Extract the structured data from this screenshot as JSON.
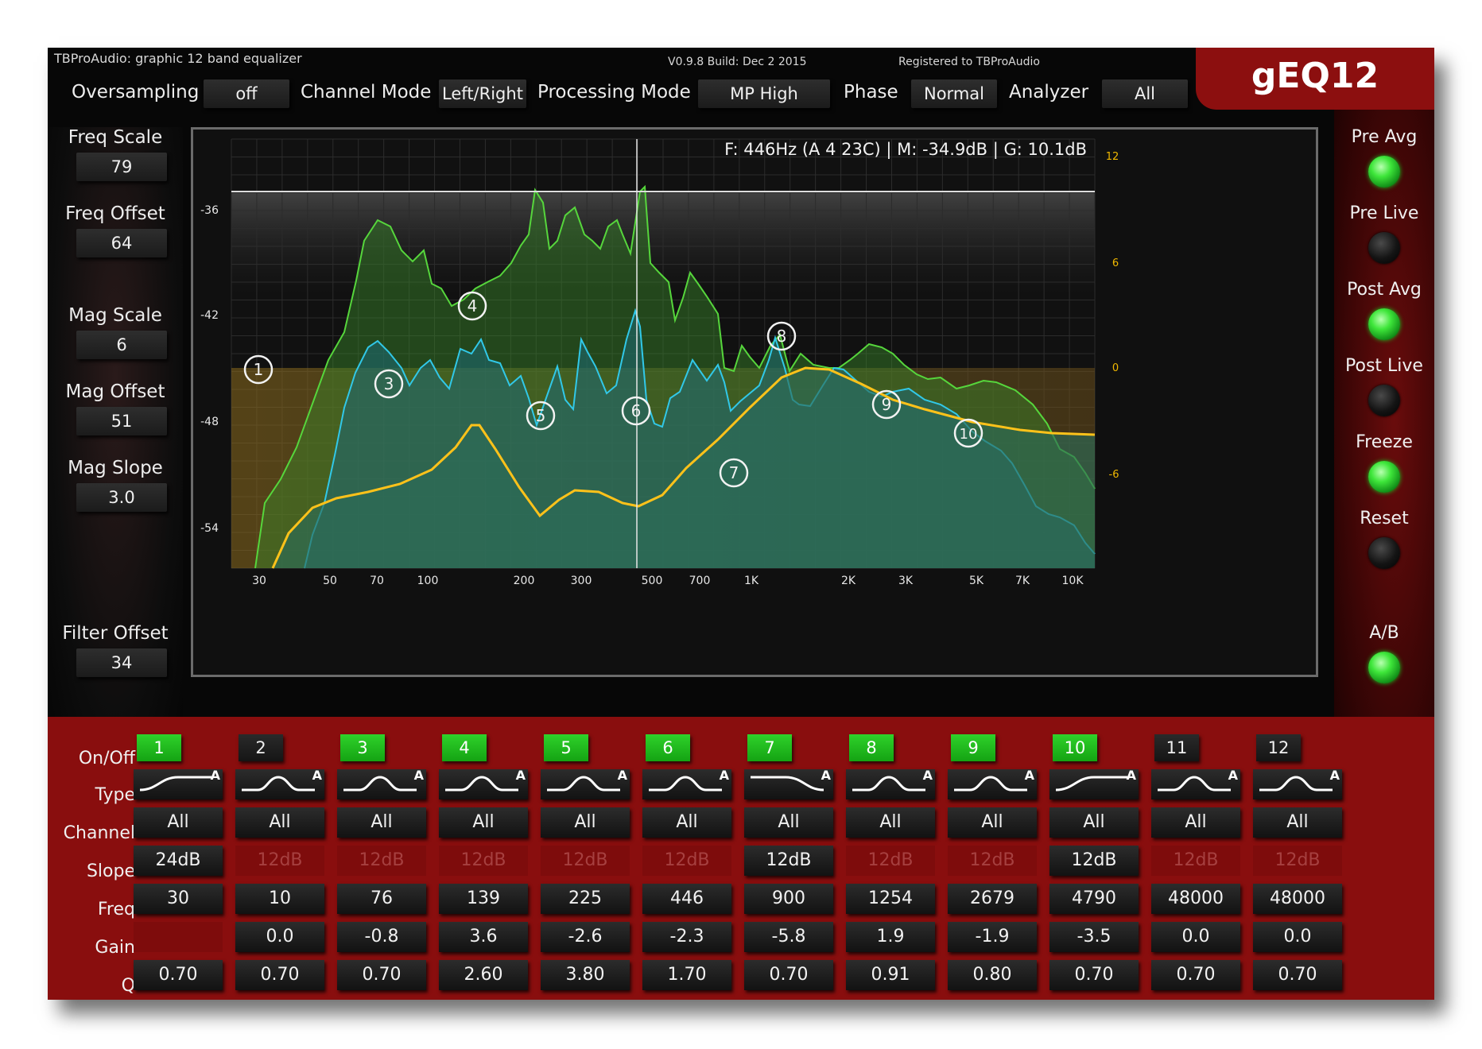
{
  "header": {
    "app_title": "TBProAudio: graphic 12 band equalizer",
    "version": "V0.9.8 Build: Dec  2 2015",
    "registered": "Registered to TBProAudio",
    "brand": "gEQ12",
    "controls": [
      {
        "label": "Oversampling",
        "value": "off"
      },
      {
        "label": "Channel Mode",
        "value": "Left/Right"
      },
      {
        "label": "Processing Mode",
        "value": "MP High"
      },
      {
        "label": "Phase",
        "value": "Normal"
      },
      {
        "label": "Analyzer",
        "value": "All"
      }
    ]
  },
  "left_params": [
    {
      "label": "Freq Scale",
      "value": "79"
    },
    {
      "label": "Freq Offset",
      "value": "64"
    },
    {
      "label": "Mag Scale",
      "value": "6"
    },
    {
      "label": "Mag Offset",
      "value": "51"
    },
    {
      "label": "Mag Slope",
      "value": "3.0"
    },
    {
      "label": "Filter Offset",
      "value": "34"
    }
  ],
  "right_controls": [
    {
      "label": "Pre Avg",
      "state": "on"
    },
    {
      "label": "Pre Live",
      "state": "off"
    },
    {
      "label": "Post Avg",
      "state": "on"
    },
    {
      "label": "Post Live",
      "state": "off"
    },
    {
      "label": "Freeze",
      "state": "on"
    },
    {
      "label": "Reset",
      "state": "off"
    },
    {
      "label": "A/B",
      "state": "on"
    }
  ],
  "graph": {
    "readout": "F: 446Hz (A 4 23C) | M: -34.9dB | G: 10.1dB",
    "left_axis": [
      "-36",
      "-42",
      "-48",
      "-54"
    ],
    "right_axis": [
      "12",
      "6",
      "0",
      "-6"
    ],
    "freq_labels": [
      "30",
      "50",
      "70",
      "100",
      "200",
      "300",
      "500",
      "700",
      "1K",
      "2K",
      "3K",
      "5K",
      "7K",
      "10K"
    ],
    "markers": [
      "1",
      "3",
      "4",
      "5",
      "6",
      "7",
      "8",
      "9",
      "10"
    ],
    "colors": {
      "pre": "#56d63c",
      "post": "#31c8e8",
      "eq": "#ffc21a",
      "grid": "#2c2c2c"
    }
  },
  "row_labels": {
    "onoff": "On/Off",
    "type": "Type",
    "channel": "Channel",
    "slope": "Slope",
    "freq": "Freq",
    "gain": "Gain",
    "q": "Q"
  },
  "type_badge": "A",
  "bands": [
    {
      "num": "1",
      "on": true,
      "type": "high-shelf-icon",
      "channel": "All",
      "slope": "24dB",
      "slope_active": true,
      "freq": "30",
      "gain": "",
      "q": "0.70"
    },
    {
      "num": "2",
      "on": false,
      "type": "peak-icon",
      "channel": "All",
      "slope": "12dB",
      "slope_active": false,
      "freq": "10",
      "gain": "0.0",
      "q": "0.70"
    },
    {
      "num": "3",
      "on": true,
      "type": "peak-icon",
      "channel": "All",
      "slope": "12dB",
      "slope_active": false,
      "freq": "76",
      "gain": "-0.8",
      "q": "0.70"
    },
    {
      "num": "4",
      "on": true,
      "type": "peak-icon",
      "channel": "All",
      "slope": "12dB",
      "slope_active": false,
      "freq": "139",
      "gain": "3.6",
      "q": "2.60"
    },
    {
      "num": "5",
      "on": true,
      "type": "peak-icon",
      "channel": "All",
      "slope": "12dB",
      "slope_active": false,
      "freq": "225",
      "gain": "-2.6",
      "q": "3.80"
    },
    {
      "num": "6",
      "on": true,
      "type": "peak-icon",
      "channel": "All",
      "slope": "12dB",
      "slope_active": false,
      "freq": "446",
      "gain": "-2.3",
      "q": "1.70"
    },
    {
      "num": "7",
      "on": true,
      "type": "low-shelf-icon",
      "channel": "All",
      "slope": "12dB",
      "slope_active": true,
      "freq": "900",
      "gain": "-5.8",
      "q": "0.70"
    },
    {
      "num": "8",
      "on": true,
      "type": "peak-icon",
      "channel": "All",
      "slope": "12dB",
      "slope_active": false,
      "freq": "1254",
      "gain": "1.9",
      "q": "0.91"
    },
    {
      "num": "9",
      "on": true,
      "type": "peak-icon",
      "channel": "All",
      "slope": "12dB",
      "slope_active": false,
      "freq": "2679",
      "gain": "-1.9",
      "q": "0.80"
    },
    {
      "num": "10",
      "on": true,
      "type": "high-shelf-icon",
      "channel": "All",
      "slope": "12dB",
      "slope_active": true,
      "freq": "4790",
      "gain": "-3.5",
      "q": "0.70"
    },
    {
      "num": "11",
      "on": false,
      "type": "peak-icon",
      "channel": "All",
      "slope": "12dB",
      "slope_active": false,
      "freq": "48000",
      "gain": "0.0",
      "q": "0.70"
    },
    {
      "num": "12",
      "on": false,
      "type": "peak-icon",
      "channel": "All",
      "slope": "12dB",
      "slope_active": false,
      "freq": "48000",
      "gain": "0.0",
      "q": "0.70"
    }
  ]
}
